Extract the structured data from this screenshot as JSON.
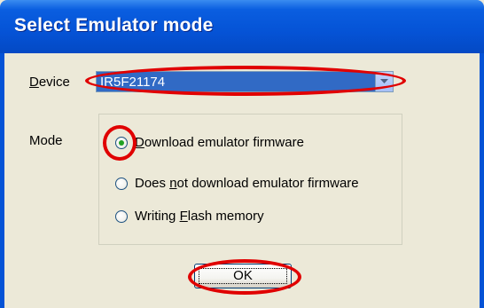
{
  "window": {
    "title": "Select Emulator mode"
  },
  "device": {
    "label_accel": "D",
    "label_rest": "evice",
    "selected_value": "IR5F21174"
  },
  "mode": {
    "label": "Mode",
    "options": [
      {
        "pre": "",
        "accel": "D",
        "post": "ownload emulator firmware",
        "selected": true
      },
      {
        "pre": "Does ",
        "accel": "n",
        "post": "ot download emulator firmware",
        "selected": false
      },
      {
        "pre": "Writing ",
        "accel": "F",
        "post": "lash memory",
        "selected": false
      }
    ]
  },
  "ok_button": {
    "label": "OK"
  },
  "icons": {
    "dropdown": "chevron-down-icon"
  },
  "colors": {
    "titlebar": "#0553d6",
    "selection": "#316ac5",
    "annotation": "#e00000",
    "radio_dot": "#21a121"
  }
}
